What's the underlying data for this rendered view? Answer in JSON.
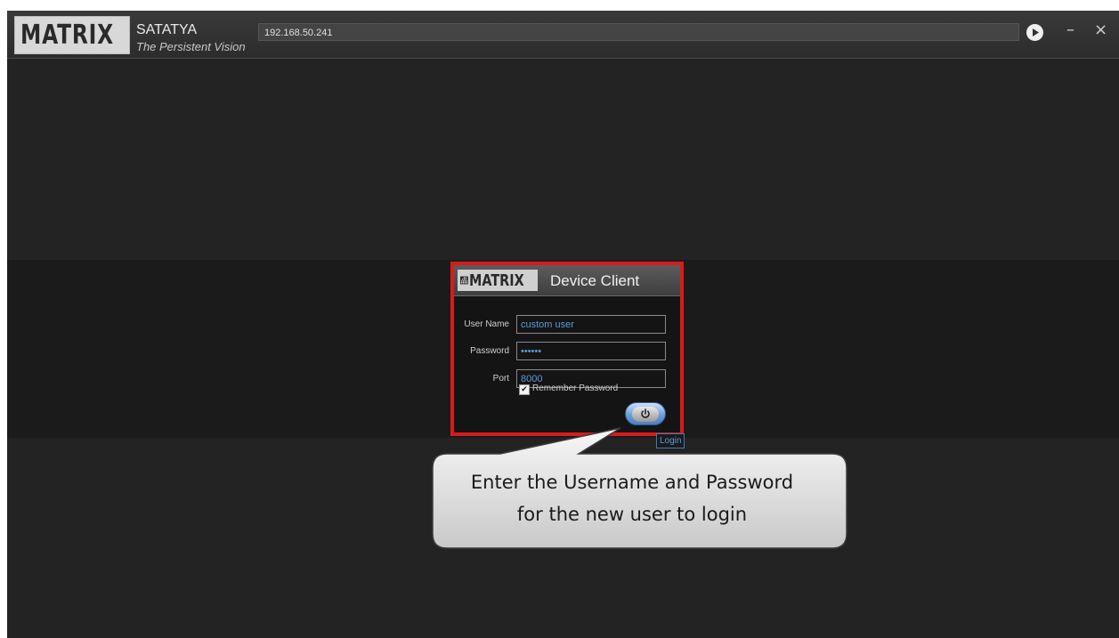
{
  "titlebar": {
    "logo_text": "MATRIX",
    "app_name": "SATATYA",
    "tagline": "The Persistent Vision",
    "address": "192.168.50.241",
    "minimize_label": "–",
    "close_label": "×"
  },
  "dialog": {
    "logo_text": "MATRIX",
    "title": "Device  Client",
    "username_label": "User Name",
    "username_value": "custom user",
    "password_label": "Password",
    "password_value": "••••••",
    "port_label": "Port",
    "port_value": "8000",
    "remember_label": "Remember Password",
    "remember_checked": true,
    "login_tooltip": "Login"
  },
  "callout": {
    "line1": "Enter the Username and Password",
    "line2": "for the new user to login"
  },
  "colors": {
    "highlight_border": "#d81b1b",
    "input_text": "#5b9bd5",
    "background": "#232323"
  }
}
